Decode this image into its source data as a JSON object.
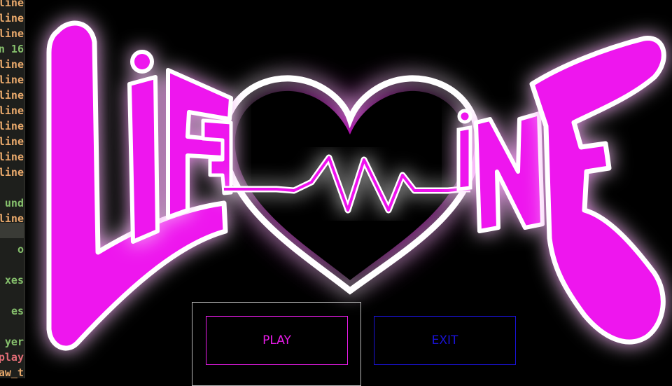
{
  "editor": {
    "lines": [
      {
        "text": "line",
        "color": "#e9a96b"
      },
      {
        "text": "line",
        "color": "#e9a96b"
      },
      {
        "text": "line",
        "color": "#e9a96b"
      },
      {
        "text": "n 16",
        "color": "#86c06c"
      },
      {
        "text": "line",
        "color": "#e9a96b"
      },
      {
        "text": "line",
        "color": "#e9a96b"
      },
      {
        "text": "line",
        "color": "#e9a96b"
      },
      {
        "text": "line",
        "color": "#e9a96b"
      },
      {
        "text": "line",
        "color": "#e9a96b"
      },
      {
        "text": "line",
        "color": "#e9a96b"
      },
      {
        "text": "line",
        "color": "#e9a96b"
      },
      {
        "text": "line",
        "color": "#e9a96b"
      },
      {
        "text": "",
        "color": "#e9a96b"
      },
      {
        "text": "und",
        "color": "#86c06c"
      },
      {
        "text": "line",
        "color": "#e9a96b"
      },
      {
        "text": "",
        "color": "#e9a96b"
      },
      {
        "text": "o",
        "color": "#86c06c"
      },
      {
        "text": "",
        "color": "#e9a96b"
      },
      {
        "text": "xes",
        "color": "#86c06c"
      },
      {
        "text": "",
        "color": "#e9a96b"
      },
      {
        "text": "es",
        "color": "#86c06c"
      },
      {
        "text": "",
        "color": "#e9a96b"
      },
      {
        "text": "yer",
        "color": "#86c06c"
      },
      {
        "text": "play",
        "color": "#e06c75"
      },
      {
        "text": "aw_t",
        "color": "#e9a96b"
      }
    ]
  },
  "logo": {
    "left_word": "LiFE",
    "right_word": "liNE",
    "colors": {
      "fill": "#ee12ee",
      "outline": "#ffffff",
      "glow": "#ff00ff"
    }
  },
  "menu": {
    "play_label": "PLAY",
    "exit_label": "EXIT",
    "colors": {
      "play": "#e81be8",
      "exit": "#1a12d6",
      "frame": "#b7b7b7"
    }
  }
}
